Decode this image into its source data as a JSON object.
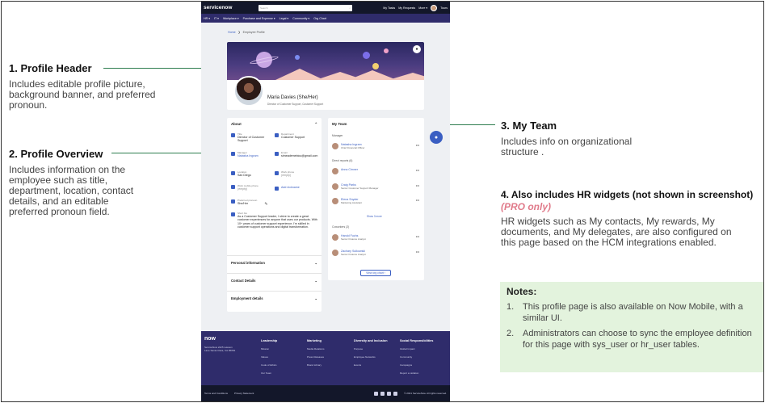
{
  "annotations": {
    "profile_header": {
      "title": "1. Profile Header",
      "text": "Includes editable profile picture, background banner, and preferred pronoun."
    },
    "profile_overview": {
      "title": "2. Profile Overview",
      "text": "Includes information on the employee such as title, department, location, contact details, and an editable preferred pronoun field."
    },
    "my_team": {
      "title": "3. My Team",
      "text": "Includes info on organizational structure ."
    },
    "hr_widgets": {
      "title": "4. Also includes HR widgets (not shown in screenshot)",
      "pro": "(PRO only)",
      "text": "HR widgets such as My contacts, My rewards, My documents, and My delegates, are also configured on this page based on the HCM integrations enabled."
    }
  },
  "notes": {
    "title": "Notes:",
    "items": [
      {
        "num": "1.",
        "text": "This profile page is also available on Now Mobile, with a similar UI."
      },
      {
        "num": "2.",
        "text": "Administrators can choose to sync the employee definition for this page with sys_user or hr_user tables."
      }
    ]
  },
  "app": {
    "logo": "servicenow",
    "search_placeholder": "Search",
    "top_links": [
      "My Tasks",
      "My Requests",
      "More ▾",
      "Tours"
    ],
    "nav": [
      "HR ▾",
      "IT ▾",
      "Workplace ▾",
      "Purchase and Expense ▾",
      "Legal ▾",
      "Community ▾",
      "Org Chart"
    ],
    "breadcrumb": {
      "home": "Home",
      "sep": "❯",
      "current": "Employee Profile"
    },
    "profile": {
      "name": "Maria Davies (She/Her)",
      "title": "Director of Customer Support, Customer Support"
    },
    "about": {
      "header": "About",
      "title_label": "Title",
      "title_value": "Director of Customer Support",
      "dept_label": "Department",
      "dept_value": "Customer Support",
      "manager_label": "Manager",
      "manager_value": "Natasha Ingram",
      "email_label": "Email",
      "email_value": "simeademebiou@gmail.com",
      "location_label": "Location",
      "location_value": "San Diego",
      "workphone_label": "Work phone",
      "workphone_value": "(empty)",
      "mobile_label": "Work mobile phone",
      "mobile_value": "(empty)",
      "add_nickname": "Add nickname",
      "pronoun_label": "Preferred pronoun",
      "pronoun_value": "She/Her",
      "bio_label": "Short bio",
      "bio_value": "As a Customer Support leader, I strive to create a great customer experiences for anyone that uses our products. With 10+ years of customer support experience, I'm skilled in customer support operations and digital transformation.",
      "sections": [
        "Personal information",
        "Contact Details",
        "Employment details"
      ]
    },
    "team": {
      "header": "My Team",
      "manager_label": "Manager",
      "manager": {
        "name": "Natasha Ingram",
        "role": "Chief Financial Officer"
      },
      "direct_label": "Direct reports (6)",
      "direct": [
        {
          "name": "Anna Cimner",
          "role": ""
        },
        {
          "name": "Craig Parks",
          "role": "Senior Customer Support Manager"
        },
        {
          "name": "Elena Snyder",
          "role": "Marketing Assistant"
        }
      ],
      "show_more": "Show 3 more",
      "coworkers_label": "Coworkers (2)",
      "coworkers": [
        {
          "name": "Harold Fuchs",
          "role": "Senior Finance Analyst"
        },
        {
          "name": "Zachary Sulkowski",
          "role": "Senior Finance Analyst"
        }
      ],
      "org_button": "View org chart ›"
    },
    "footer": {
      "logo": "now",
      "address": "ServiceNow 2225 Lawson Lane Santa Clara, CA 95054",
      "columns": [
        {
          "h": "Leadership",
          "links": [
            "Mission",
            "Values",
            "Code of Ethics",
            "Our Team"
          ]
        },
        {
          "h": "Marketing",
          "links": [
            "Media Relations",
            "Press Releases",
            "Brand Library"
          ]
        },
        {
          "h": "Diversity and Inclusion",
          "links": [
            "Purpose",
            "Employee Networks",
            "Events"
          ]
        },
        {
          "h": "Social Responsibilities",
          "links": [
            "Global Impact",
            "Community",
            "Campaigns",
            "Report a violation"
          ]
        }
      ],
      "terms": "Terms and Conditions",
      "privacy": "Privacy Statement",
      "copyright": "© 2021 ServiceNow. All rights reserved."
    }
  }
}
